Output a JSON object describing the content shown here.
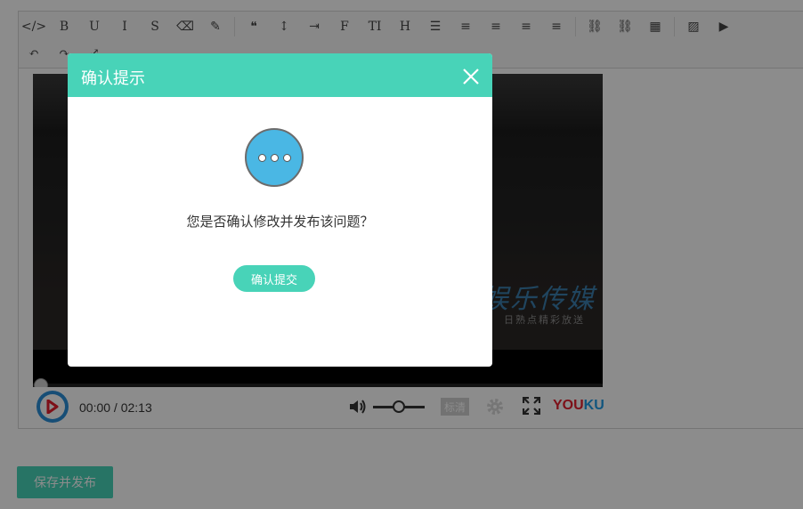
{
  "editor": {
    "toolbar_row1": [
      {
        "name": "code-icon",
        "glyph": "</>"
      },
      {
        "name": "bold-icon",
        "glyph": "B"
      },
      {
        "name": "underline-icon",
        "glyph": "U"
      },
      {
        "name": "italic-icon",
        "glyph": "I"
      },
      {
        "name": "strikethrough-icon",
        "glyph": "S"
      },
      {
        "name": "eraser-icon",
        "glyph": "⌫"
      },
      {
        "name": "pencil-icon",
        "glyph": "✎"
      },
      {
        "name": "quote-icon",
        "glyph": "❝"
      },
      {
        "name": "line-height-icon",
        "glyph": "↕"
      },
      {
        "name": "indent-icon",
        "glyph": "⇥"
      },
      {
        "name": "font-family-icon",
        "glyph": "F"
      },
      {
        "name": "font-size-icon",
        "glyph": "TI"
      },
      {
        "name": "heading-icon",
        "glyph": "H"
      },
      {
        "name": "unordered-list-icon",
        "glyph": "☰"
      },
      {
        "name": "ordered-list-icon",
        "glyph": "≡"
      },
      {
        "name": "align-left-icon",
        "glyph": "≡"
      },
      {
        "name": "align-center-icon",
        "glyph": "≡"
      },
      {
        "name": "align-right-icon",
        "glyph": "≡"
      },
      {
        "name": "link-icon",
        "glyph": "⛓"
      },
      {
        "name": "unlink-icon",
        "glyph": "⛓"
      },
      {
        "name": "table-icon",
        "glyph": "▦"
      },
      {
        "name": "image-icon",
        "glyph": "▨"
      },
      {
        "name": "video-icon",
        "glyph": "▶"
      }
    ],
    "toolbar_row2": [
      {
        "name": "undo-icon",
        "glyph": "↶"
      },
      {
        "name": "redo-icon",
        "glyph": "↷"
      },
      {
        "name": "fullscreen-editor-icon",
        "glyph": "⤢"
      }
    ]
  },
  "video": {
    "watermark": "娱乐传媒",
    "watermark_sub": "日熟点精彩放送",
    "current_time": "00:00",
    "duration": "02:13",
    "time_separator": " / ",
    "quality_label": "标清",
    "brand_you": "YOU",
    "brand_ku": "KU",
    "progress": 0,
    "volume": 0.5
  },
  "save_button_label": "保存并发布",
  "modal": {
    "title": "确认提示",
    "message": "您是否确认修改并发布该问题？",
    "confirm_label": "确认提交"
  },
  "colors": {
    "accent": "#48d3b8",
    "icon_blue": "#4ab7e4"
  }
}
